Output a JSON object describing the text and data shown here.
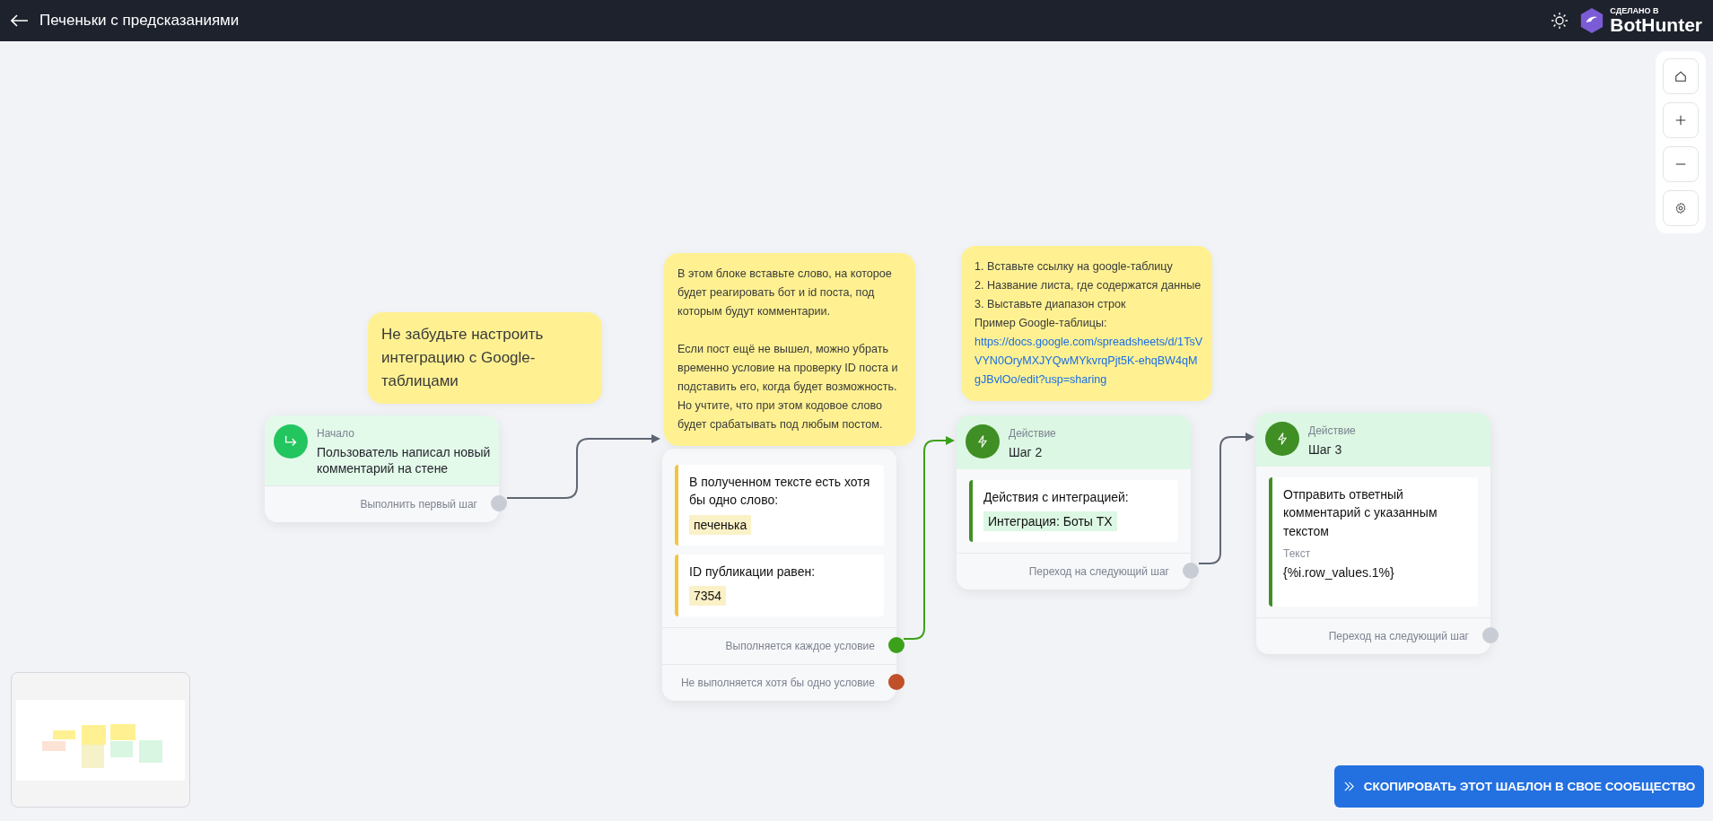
{
  "header": {
    "title": "Печеньки с предсказаниями",
    "brand_caption": "СДЕЛАНО В",
    "brand_name": "BotHunter"
  },
  "notes": [
    {
      "kind": "large",
      "paragraphs": [
        [
          "Не забудьте настроить интеграцию с Google-таблицами"
        ]
      ]
    },
    {
      "kind": "normal",
      "paragraphs": [
        [
          "В этом блоке вставьте слово, на которое будет реагировать бот и id поста, под которым будут комментарии."
        ],
        [
          "Если пост ещё не вышел, можно убрать временно условие на проверку ID поста и подставить его, когда будет возможность. Но учтите, что при этом кодовое слово будет срабатывать под любым постом."
        ]
      ]
    },
    {
      "kind": "normal",
      "paragraphs": [
        [
          "1. Вставьте ссылку на google-таблицу",
          "2. Название листа, где содержатся данные",
          "3. Выставьте диапазон строк",
          "Пример Google-таблицы:"
        ]
      ],
      "link": "https://docs.google.com/spreadsheets/d/1TsVVYN0OryMXJYQwMYkvrqPjt5K-ehqBW4qMgJBvlOo/edit?usp=sharing"
    }
  ],
  "nodes": [
    {
      "kind": "start",
      "label": "Начало",
      "title": "Пользователь написал новый комментарий на стене",
      "outputs": [
        {
          "label": "Выполнить первый шаг",
          "color": "#c8ccd4"
        }
      ]
    },
    {
      "kind": "condition",
      "items": [
        {
          "title": "В полученном тексте есть хотя бы одно слово:",
          "tag": "печенька"
        },
        {
          "title": "ID публикации равен:",
          "tag": "7354"
        }
      ],
      "outputs": [
        {
          "label": "Выполняется каждое условие",
          "color": "#3ba11a"
        },
        {
          "label": "Не выполняется хотя бы одно условие",
          "color": "#c0502a"
        }
      ]
    },
    {
      "kind": "action",
      "label": "Действие",
      "title": "Шаг 2",
      "items": [
        {
          "title": "Действия с интеграцией:",
          "tag": "Интеграция: Боты TX"
        }
      ],
      "outputs": [
        {
          "label": "Переход на следующий шаг",
          "color": "#c8ccd4"
        }
      ]
    },
    {
      "kind": "action",
      "label": "Действие",
      "title": "Шаг 3",
      "items": [
        {
          "title": "Отправить ответный комментарий с указанным текстом",
          "field_label": "Текст",
          "field_value": "{%i.row_values.1%}"
        }
      ],
      "outputs": [
        {
          "label": "Переход на следующий шаг",
          "color": "#c8ccd4"
        }
      ]
    }
  ],
  "copy_button": {
    "label": "СКОПИРОВАТЬ ЭТОТ ШАБЛОН В СВОЕ СООБЩЕСТВО"
  }
}
